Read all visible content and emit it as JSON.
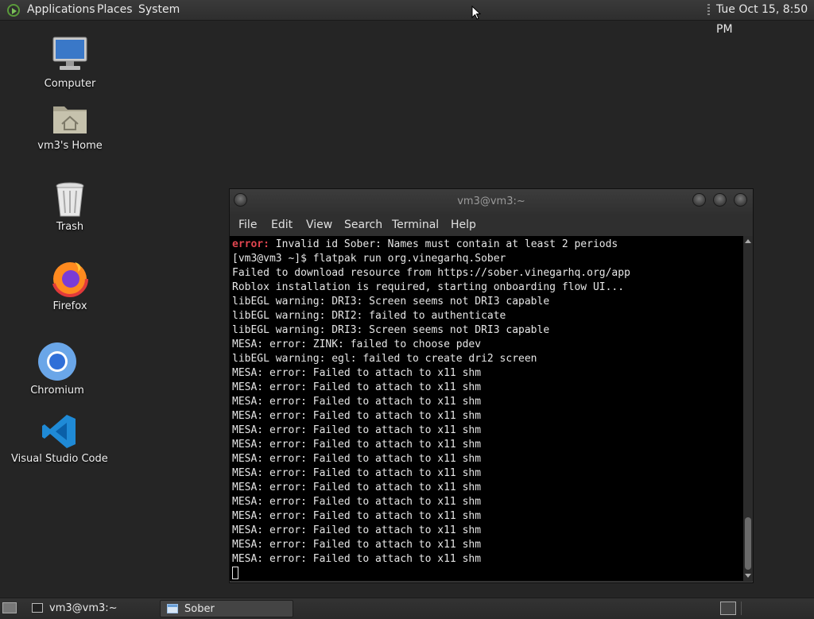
{
  "top_panel": {
    "menus": [
      "Applications",
      "Places",
      "System"
    ],
    "clock": "Tue Oct 15,  8:50 PM"
  },
  "desktop_icons": [
    {
      "label": "Computer",
      "icon": "computer-icon"
    },
    {
      "label": "vm3's Home",
      "icon": "home-folder-icon"
    },
    {
      "label": "Trash",
      "icon": "trash-icon"
    },
    {
      "label": "Firefox",
      "icon": "firefox-icon"
    },
    {
      "label": "Chromium",
      "icon": "chromium-icon"
    },
    {
      "label": "Visual Studio Code",
      "icon": "vscode-icon"
    }
  ],
  "terminal": {
    "title": "vm3@vm3:~",
    "menus": [
      "File",
      "Edit",
      "View",
      "Search",
      "Terminal",
      "Help"
    ],
    "lines": [
      {
        "prefix": "error:",
        "text": " Invalid id Sober: Names must contain at least 2 periods"
      },
      {
        "text": "[vm3@vm3 ~]$ flatpak run org.vinegarhq.Sober"
      },
      {
        "text": "Failed to download resource from https://sober.vinegarhq.org/app"
      },
      {
        "text": "Roblox installation is required, starting onboarding flow UI..."
      },
      {
        "text": "libEGL warning: DRI3: Screen seems not DRI3 capable"
      },
      {
        "text": "libEGL warning: DRI2: failed to authenticate"
      },
      {
        "text": "libEGL warning: DRI3: Screen seems not DRI3 capable"
      },
      {
        "text": "MESA: error: ZINK: failed to choose pdev"
      },
      {
        "text": "libEGL warning: egl: failed to create dri2 screen"
      },
      {
        "text": "MESA: error: Failed to attach to x11 shm"
      },
      {
        "text": "MESA: error: Failed to attach to x11 shm"
      },
      {
        "text": "MESA: error: Failed to attach to x11 shm"
      },
      {
        "text": "MESA: error: Failed to attach to x11 shm"
      },
      {
        "text": "MESA: error: Failed to attach to x11 shm"
      },
      {
        "text": "MESA: error: Failed to attach to x11 shm"
      },
      {
        "text": "MESA: error: Failed to attach to x11 shm"
      },
      {
        "text": "MESA: error: Failed to attach to x11 shm"
      },
      {
        "text": "MESA: error: Failed to attach to x11 shm"
      },
      {
        "text": "MESA: error: Failed to attach to x11 shm"
      },
      {
        "text": "MESA: error: Failed to attach to x11 shm"
      },
      {
        "text": "MESA: error: Failed to attach to x11 shm"
      },
      {
        "text": "MESA: error: Failed to attach to x11 shm"
      },
      {
        "text": "MESA: error: Failed to attach to x11 shm"
      }
    ]
  },
  "taskbar": {
    "tasks": [
      {
        "label": "vm3@vm3:~",
        "icon": "terminal-icon",
        "active": false
      },
      {
        "label": "Sober",
        "icon": "window-icon",
        "active": true
      }
    ]
  },
  "colors": {
    "error": "#e0454f",
    "terminal_bg": "#000000",
    "desktop_bg": "#252525"
  }
}
